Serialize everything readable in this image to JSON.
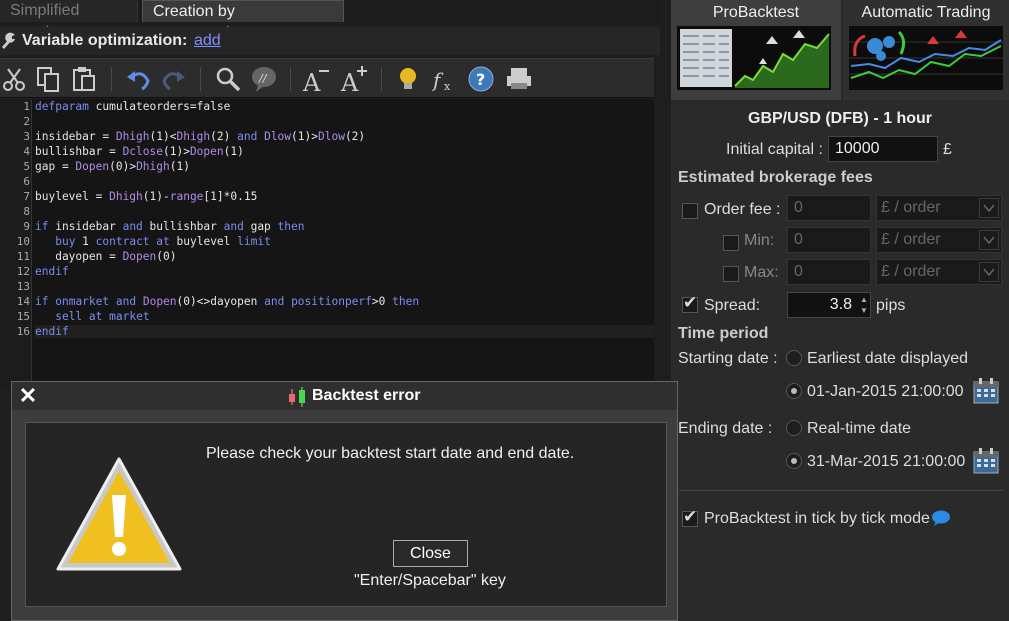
{
  "tabs": {
    "simplified": "Simplified creation",
    "programming": "Creation by programming"
  },
  "varopt": {
    "label": "Variable optimization:",
    "link": "add"
  },
  "toolbar": {
    "icons": [
      "cut-icon",
      "copy-icon",
      "paste-icon",
      "undo-icon",
      "redo-icon",
      "search-icon",
      "comment-icon",
      "decrease-font-icon",
      "increase-font-icon",
      "lightbulb-icon",
      "function-icon",
      "help-icon",
      "print-icon"
    ]
  },
  "code": {
    "line_numbers": [
      "1",
      "2",
      "3",
      "4",
      "5",
      "6",
      "7",
      "8",
      "9",
      "10",
      "11",
      "12",
      "13",
      "14",
      "15",
      "16"
    ],
    "lines": [
      "defparam cumulateorders=false",
      "",
      "insidebar = Dhigh(1)<Dhigh(2) and Dlow(1)>Dlow(2)",
      "bullishbar = Dclose(1)>Dopen(1)",
      "gap = Dopen(0)>Dhigh(1)",
      "",
      "buylevel = Dhigh(1)-range[1]*0.15",
      "",
      "if insidebar and bullishbar and gap then",
      "   buy 1 contract at buylevel limit",
      "   dayopen = Dopen(0)",
      "endif",
      "",
      "if onmarket and Dopen(0)<>dayopen and positionperf>0 then",
      "   sell at market",
      "endif"
    ]
  },
  "right": {
    "tab_backtest": "ProBacktest",
    "tab_auto": "Automatic Trading",
    "instrument": "GBP/USD (DFB) - 1 hour",
    "initial_capital_label": "Initial capital :",
    "initial_capital_value": "10000",
    "currency": "£",
    "fees_title": "Estimated brokerage fees",
    "order_fee_label": "Order fee :",
    "order_fee_value": "0",
    "order_fee_unit": "£ / order",
    "min_label": "Min:",
    "min_value": "0",
    "min_unit": "£ / order",
    "max_label": "Max:",
    "max_value": "0",
    "max_unit": "£ / order",
    "spread_label": "Spread:",
    "spread_value": "3.8",
    "spread_unit": "pips",
    "time_period_title": "Time period",
    "starting_label": "Starting date :",
    "start_opt1": "Earliest date displayed",
    "start_opt2": "01-Jan-2015 21:00:00",
    "ending_label": "Ending date :",
    "end_opt1": "Real-time date",
    "end_opt2": "31-Mar-2015 21:00:00",
    "tick_mode": "ProBacktest in tick by tick mode"
  },
  "dialog": {
    "title": "Backtest error",
    "message": "Please check your backtest start date and end date.",
    "button": "Close",
    "hint": "\"Enter/Spacebar\" key"
  },
  "colors": {
    "background": "#1e1e1e",
    "link": "#7f8fff",
    "keyword": "#7a8cf0",
    "function": "#b08ce8",
    "warning": "#f0c020"
  }
}
